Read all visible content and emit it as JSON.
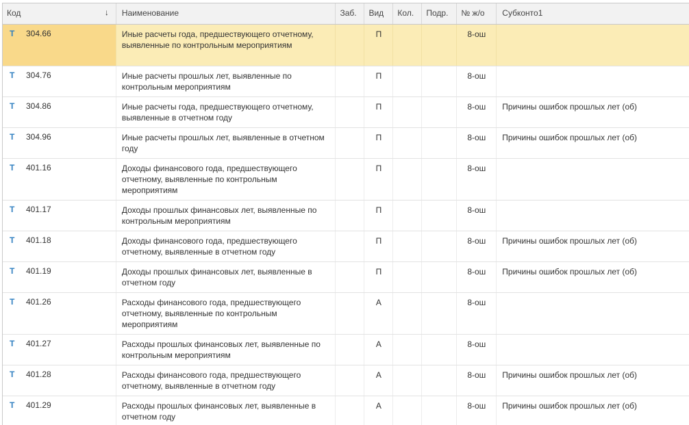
{
  "table": {
    "columns": {
      "code": "Код",
      "name": "Наименование",
      "zab": "Заб.",
      "vid": "Вид",
      "kol": "Кол.",
      "podr": "Подр.",
      "num": "№ ж/о",
      "sub1": "Субконто1"
    },
    "sort_indicator": "↓",
    "type_glyph": "Т",
    "rows": [
      {
        "code": "304.66",
        "name": "Иные расчеты года, предшествующего отчетному, выявленные по контрольным мероприятиям",
        "vid": "П",
        "num": "8-ош",
        "sub1": ""
      },
      {
        "code": "304.76",
        "name": "Иные расчеты прошлых лет, выявленные по контрольным мероприятиям",
        "vid": "П",
        "num": "8-ош",
        "sub1": ""
      },
      {
        "code": "304.86",
        "name": "Иные расчеты года, предшествующего отчетному, выявленные в отчетном году",
        "vid": "П",
        "num": "8-ош",
        "sub1": "Причины ошибок прошлых лет (об)"
      },
      {
        "code": "304.96",
        "name": "Иные расчеты прошлых лет, выявленные в отчетном году",
        "vid": "П",
        "num": "8-ош",
        "sub1": "Причины ошибок прошлых лет (об)"
      },
      {
        "code": "401.16",
        "name": "Доходы финансового года, предшествующего отчетному, выявленные по контрольным мероприятиям",
        "vid": "П",
        "num": "8-ош",
        "sub1": ""
      },
      {
        "code": "401.17",
        "name": "Доходы прошлых финансовых лет, выявленные по контрольным мероприятиям",
        "vid": "П",
        "num": "8-ош",
        "sub1": ""
      },
      {
        "code": "401.18",
        "name": "Доходы финансового года, предшествующего отчетному, выявленные в отчетном году",
        "vid": "П",
        "num": "8-ош",
        "sub1": "Причины ошибок прошлых лет (об)"
      },
      {
        "code": "401.19",
        "name": "Доходы прошлых финансовых лет, выявленные в отчетном году",
        "vid": "П",
        "num": "8-ош",
        "sub1": "Причины ошибок прошлых лет (об)"
      },
      {
        "code": "401.26",
        "name": "Расходы финансового года, предшествующего отчетному, выявленные по контрольным мероприятиям",
        "vid": "А",
        "num": "8-ош",
        "sub1": ""
      },
      {
        "code": "401.27",
        "name": "Расходы прошлых финансовых лет, выявленные по контрольным мероприятиям",
        "vid": "А",
        "num": "8-ош",
        "sub1": ""
      },
      {
        "code": "401.28",
        "name": "Расходы финансового года, предшествующего отчетному, выявленные в отчетном году",
        "vid": "А",
        "num": "8-ош",
        "sub1": "Причины ошибок прошлых лет (об)"
      },
      {
        "code": "401.29",
        "name": "Расходы прошлых финансовых лет, выявленные в отчетном году",
        "vid": "А",
        "num": "8-ош",
        "sub1": "Причины ошибок прошлых лет (об)"
      }
    ]
  }
}
